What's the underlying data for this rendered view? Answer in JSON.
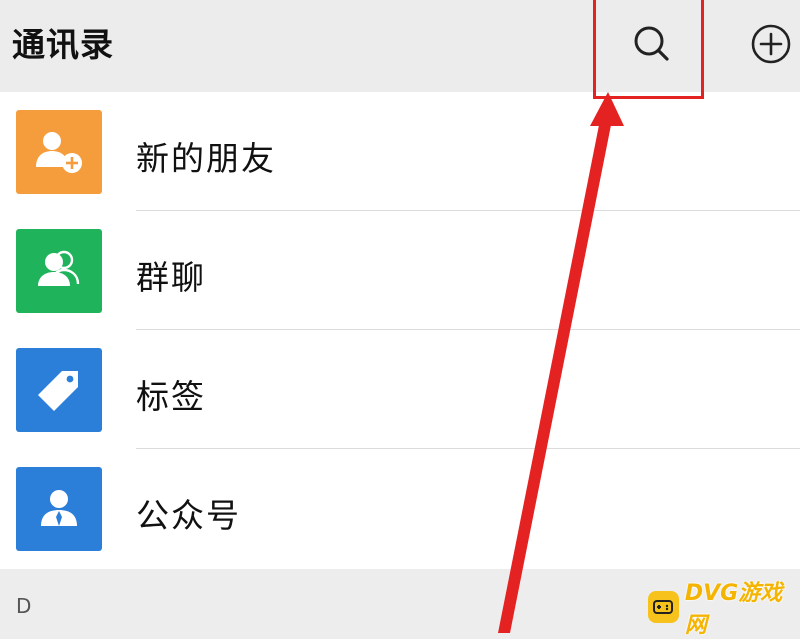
{
  "header": {
    "title": "通讯录",
    "search_icon": "search-icon",
    "add_icon": "plus-circle-icon"
  },
  "contacts_menu": {
    "items": [
      {
        "label": "新的朋友",
        "icon": "add-friend-icon",
        "color": "#f59d3c"
      },
      {
        "label": "群聊",
        "icon": "group-icon",
        "color": "#1fb35b"
      },
      {
        "label": "标签",
        "icon": "tag-icon",
        "color": "#2b7fd8"
      },
      {
        "label": "公众号",
        "icon": "official-account-icon",
        "color": "#2b7fd8"
      }
    ]
  },
  "section_index": {
    "letter": "D"
  },
  "annotation": {
    "color": "#e52222"
  },
  "watermark": {
    "text": "DVG游戏网",
    "color": "#f4b400"
  }
}
